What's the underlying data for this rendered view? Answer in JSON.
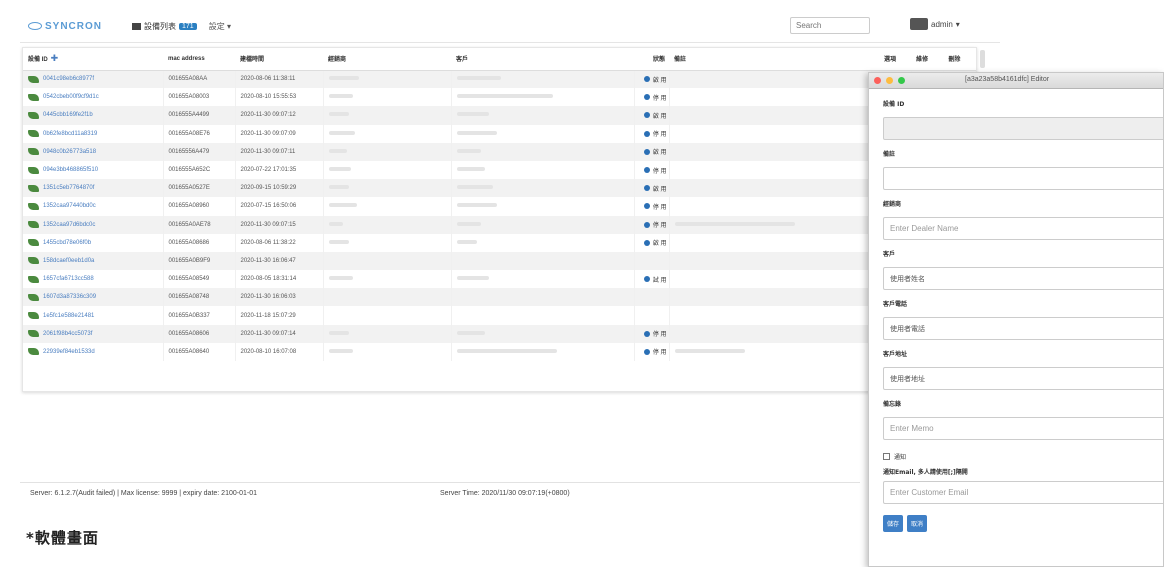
{
  "brand": "SYNCRON",
  "nav": {
    "devices_label": "設備列表",
    "devices_badge": "171",
    "settings_label": "設定",
    "search_placeholder": "Search",
    "user_label": "admin"
  },
  "table": {
    "headers": [
      "設備 ID",
      "mac address",
      "建檔時間",
      "經銷商",
      "客戶",
      "狀態",
      "備註",
      "選項",
      "維修",
      "刪除"
    ],
    "rows": [
      {
        "id": "0041c98eb6c8977f",
        "mac": "001655A08AA",
        "date": "2020-08-06 11:38:11",
        "status": "啟 用"
      },
      {
        "id": "0542cbeb00f9cf9d1c",
        "mac": "001655A08003",
        "date": "2020-08-10 15:55:53",
        "status": "停 用"
      },
      {
        "id": "0445cbb169fe2f1b",
        "mac": "0016555A4499",
        "date": "2020-11-30 09:07:12",
        "status": "啟 用"
      },
      {
        "id": "0b62fe8bcd11a8319",
        "mac": "001655A08E76",
        "date": "2020-11-30 09:07:09",
        "status": "停 用"
      },
      {
        "id": "0948c0b26773a518",
        "mac": "00165556A479",
        "date": "2020-11-30 09:07:11",
        "status": "啟 用"
      },
      {
        "id": "094e3bb468865f510",
        "mac": "0016555A652C",
        "date": "2020-07-22 17:01:35",
        "status": "停 用"
      },
      {
        "id": "1351c5eb7764870f",
        "mac": "001655A0527E",
        "date": "2020-09-15 10:59:29",
        "status": "啟 用"
      },
      {
        "id": "1352caa97440bd0c",
        "mac": "001655A08960",
        "date": "2020-07-15 16:50:06",
        "status": "停 用"
      },
      {
        "id": "1352caa97d6bdc0c",
        "mac": "001655A0AE78",
        "date": "2020-11-30 09:07:15",
        "status": "停 用"
      },
      {
        "id": "1455cbd78e06f0b",
        "mac": "001655A08686",
        "date": "2020-08-06 11:38:22",
        "status": "啟 用"
      },
      {
        "id": "158dcaef0eeb1d0a",
        "mac": "001655A0B9F9",
        "date": "2020-11-30 16:06:47",
        "status": ""
      },
      {
        "id": "1657cfa6713cc588",
        "mac": "001655A08549",
        "date": "2020-08-05 18:31:14",
        "status": "試 用"
      },
      {
        "id": "1607d3a87336c309",
        "mac": "001655A08748",
        "date": "2020-11-30 16:06:03",
        "status": ""
      },
      {
        "id": "1e5fc1e588e21481",
        "mac": "001655A0B337",
        "date": "2020-11-18 15:07:29",
        "status": ""
      },
      {
        "id": "2061f98b4cc5073f",
        "mac": "001655A08606",
        "date": "2020-11-30 09:07:14",
        "status": "停 用"
      },
      {
        "id": "22939ef84eb1533d",
        "mac": "001655A08640",
        "date": "2020-08-10 16:07:08",
        "status": "停 用"
      }
    ]
  },
  "footer": {
    "left": "Server: 6.1.2.7(Audit failed) | Max license: 9999 | expiry date: 2100-01-01",
    "right": "Server Time: 2020/11/30 09:07:19(+0800)"
  },
  "caption": "*軟體畫面",
  "editor": {
    "title": "[a3a23a58b4161dfc] Editor",
    "label_device_id": "設備 ID",
    "label_status": "備註",
    "label_dealer": "經銷商",
    "dealer_placeholder": "Enter Dealer Name",
    "label_customer": "客戶",
    "customer_value": "使用者姓名",
    "label_phone": "客戶電話",
    "phone_value": "使用者電話",
    "label_address": "客戶地址",
    "address_value": "使用者地址",
    "label_memo": "備忘錄",
    "memo_placeholder": "Enter Memo",
    "checkbox_label": "通知",
    "label_email": "通知Email, 多人請使用[;]隔開",
    "email_placeholder": "Enter Customer Email",
    "save_label": "儲存",
    "cancel_label": "取消"
  }
}
